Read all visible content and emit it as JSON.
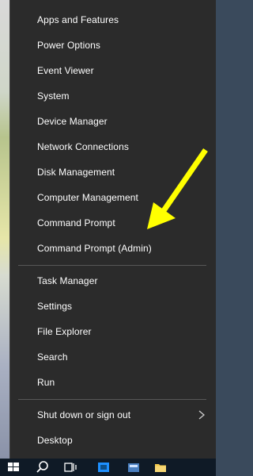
{
  "menu": {
    "group1": [
      {
        "label": "Apps and Features"
      },
      {
        "label": "Power Options"
      },
      {
        "label": "Event Viewer"
      },
      {
        "label": "System"
      },
      {
        "label": "Device Manager"
      },
      {
        "label": "Network Connections"
      },
      {
        "label": "Disk Management"
      },
      {
        "label": "Computer Management"
      },
      {
        "label": "Command Prompt"
      },
      {
        "label": "Command Prompt (Admin)"
      }
    ],
    "group2": [
      {
        "label": "Task Manager"
      },
      {
        "label": "Settings"
      },
      {
        "label": "File Explorer"
      },
      {
        "label": "Search"
      },
      {
        "label": "Run"
      }
    ],
    "group3": [
      {
        "label": "Shut down or sign out",
        "icon": "chevron-right-icon"
      },
      {
        "label": "Desktop"
      }
    ]
  },
  "annotation": {
    "icon": "yellow-arrow-icon",
    "color": "#ffff00"
  },
  "taskbar": {
    "icons": [
      "windows-start-icon",
      "search-icon",
      "task-view-icon",
      "app-icon",
      "file-explorer-icon"
    ],
    "colors": {
      "menu_bg": "#2b2b2b",
      "taskbar_bg": "#0f1a26",
      "accent": "#1e90ff"
    }
  }
}
